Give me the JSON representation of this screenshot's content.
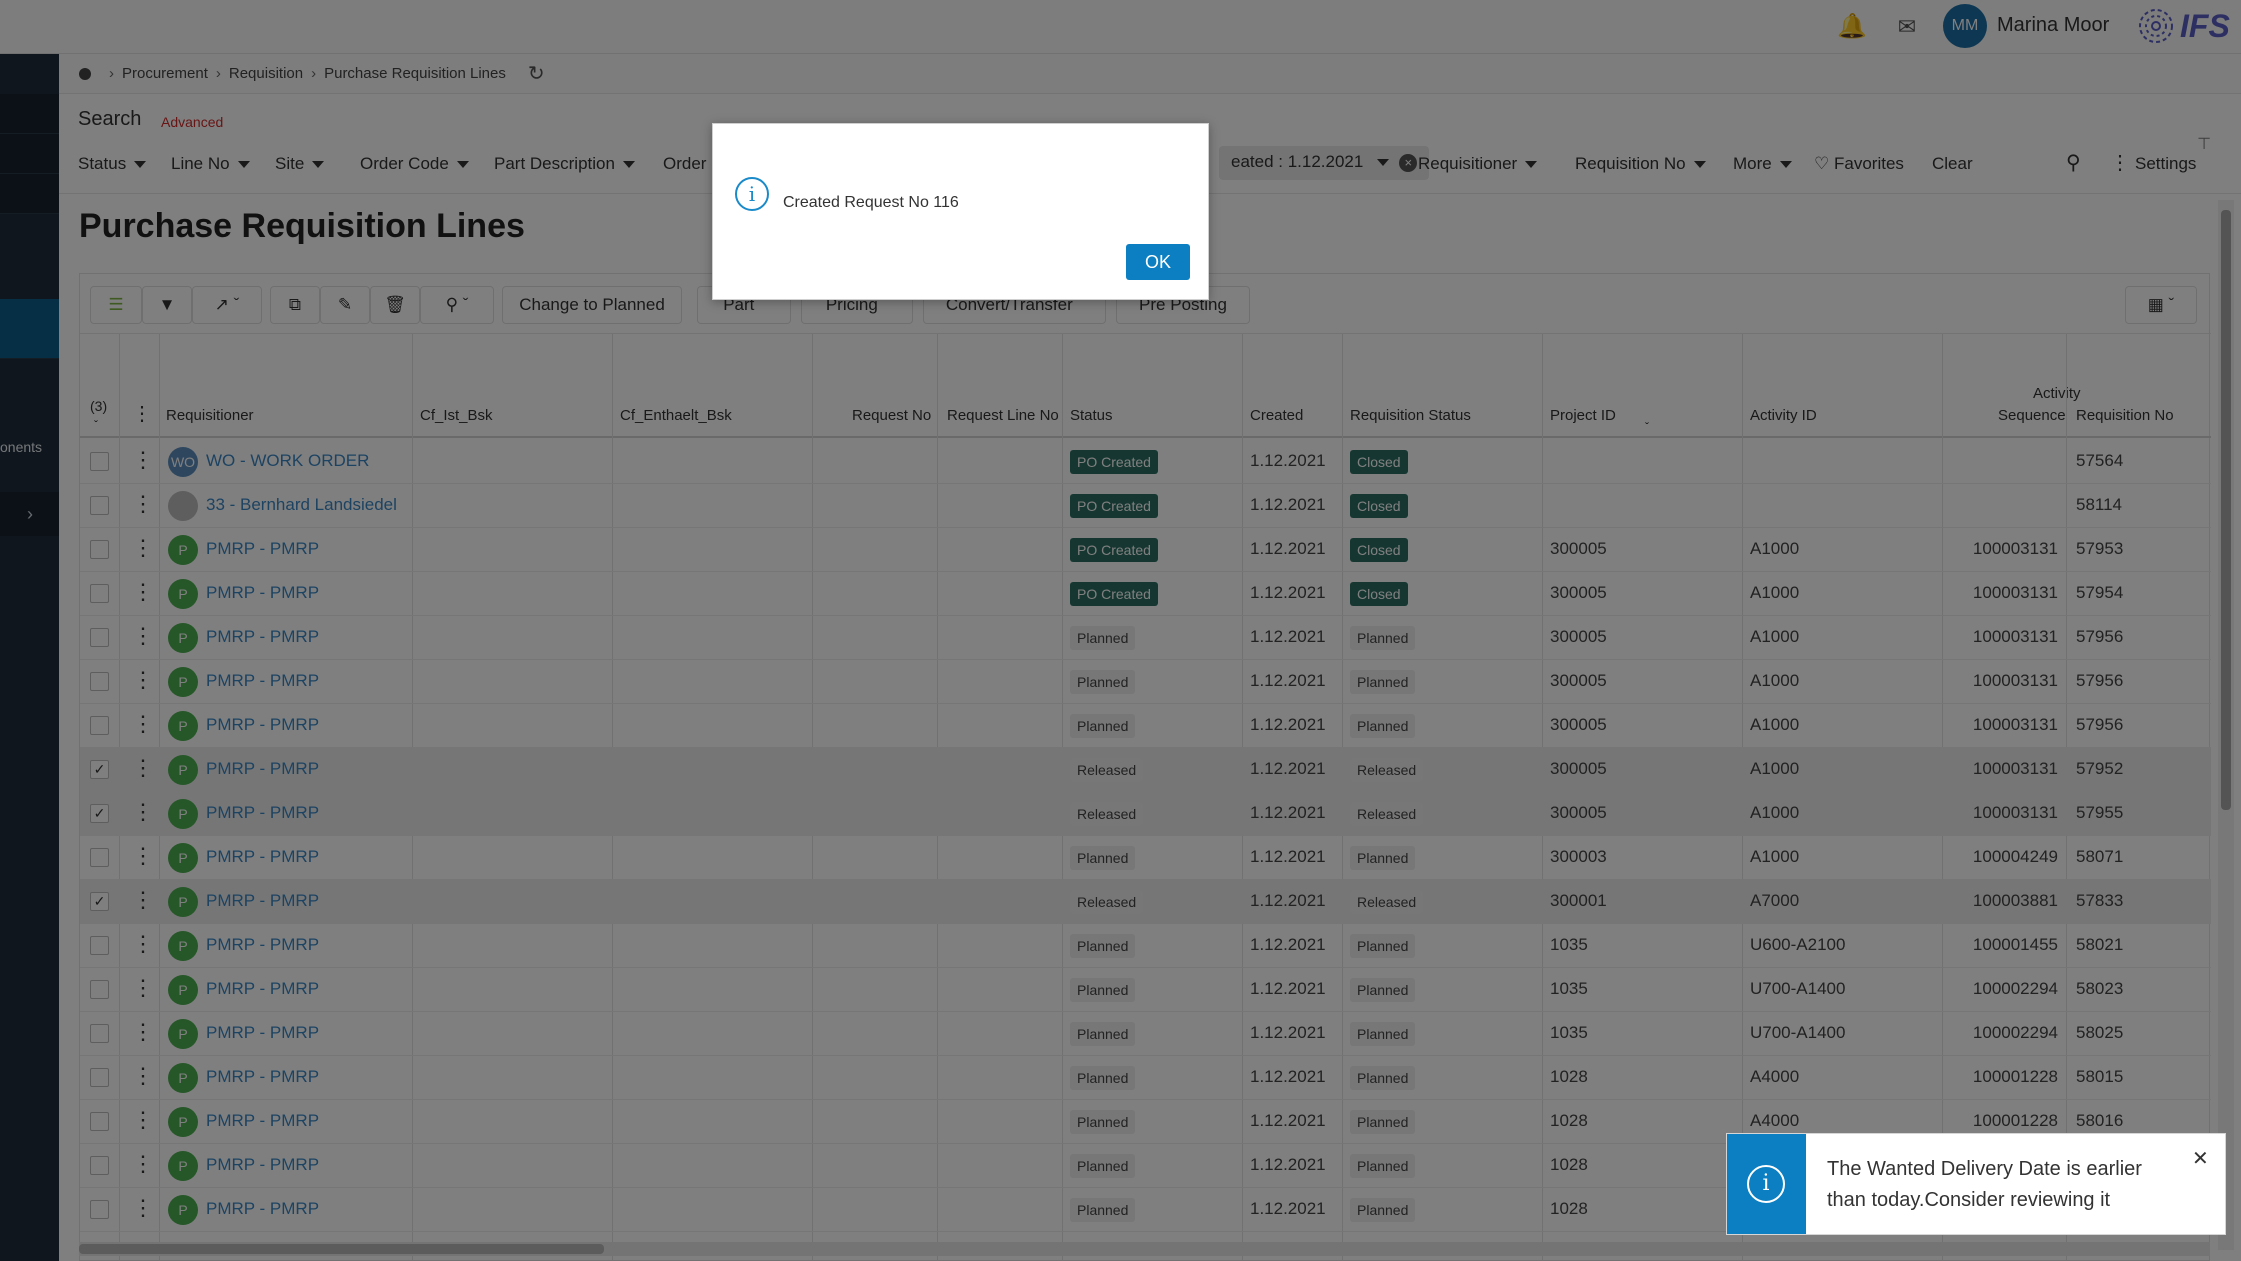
{
  "topbar": {
    "user_initials": "MM",
    "user_name": "Marina Moor",
    "logo_text": "IFS"
  },
  "nav": {
    "components_label": "onents"
  },
  "breadcrumb": [
    "Procurement",
    "Requisition",
    "Purchase Requisition Lines"
  ],
  "search": {
    "title": "Search",
    "advanced": "Advanced",
    "filters": [
      "Status",
      "Line No",
      "Site",
      "Order Code",
      "Part Description",
      "Order"
    ],
    "chip": "eated : 1.12.2021",
    "filters_right": [
      "Requisitioner",
      "Requisition No",
      "More"
    ],
    "favorites": "Favorites",
    "clear": "Clear",
    "settings": "Settings"
  },
  "page_title": "Purchase Requisition Lines",
  "toolbar": {
    "change_to_planned": "Change to Planned",
    "part": "Part",
    "pricing": "Pricing",
    "convert_transfer": "Convert/Transfer",
    "pre_posting": "Pre Posting"
  },
  "grid": {
    "selected_count": "(3)",
    "columns": {
      "requisitioner": "Requisitioner",
      "cf_ist": "Cf_Ist_Bsk",
      "cf_enthaelt": "Cf_Enthaelt_Bsk",
      "request_no": "Request No",
      "request_line_no": "Request Line No",
      "status": "Status",
      "created": "Created",
      "requisition_status": "Requisition Status",
      "project_id": "Project ID",
      "activity_id": "Activity ID",
      "activity_sequence_1": "Activity",
      "activity_sequence_2": "Sequence",
      "requisition_no": "Requisition No"
    },
    "rows": [
      {
        "checked": false,
        "avatar": "WO",
        "requisitioner": "WO - WORK ORDER",
        "status": "PO Created",
        "created": "1.12.2021",
        "req_status": "Closed",
        "project": "",
        "activity": "",
        "sequence": "",
        "req_no": "57564"
      },
      {
        "checked": false,
        "avatar": "",
        "requisitioner": "33 - Bernhard Landsiedel",
        "status": "PO Created",
        "created": "1.12.2021",
        "req_status": "Closed",
        "project": "",
        "activity": "",
        "sequence": "",
        "req_no": "58114"
      },
      {
        "checked": false,
        "avatar": "P",
        "requisitioner": "PMRP - PMRP",
        "status": "PO Created",
        "created": "1.12.2021",
        "req_status": "Closed",
        "project": "300005",
        "activity": "A1000",
        "sequence": "100003131",
        "req_no": "57953"
      },
      {
        "checked": false,
        "avatar": "P",
        "requisitioner": "PMRP - PMRP",
        "status": "PO Created",
        "created": "1.12.2021",
        "req_status": "Closed",
        "project": "300005",
        "activity": "A1000",
        "sequence": "100003131",
        "req_no": "57954"
      },
      {
        "checked": false,
        "avatar": "P",
        "requisitioner": "PMRP - PMRP",
        "status": "Planned",
        "created": "1.12.2021",
        "req_status": "Planned",
        "project": "300005",
        "activity": "A1000",
        "sequence": "100003131",
        "req_no": "57956"
      },
      {
        "checked": false,
        "avatar": "P",
        "requisitioner": "PMRP - PMRP",
        "status": "Planned",
        "created": "1.12.2021",
        "req_status": "Planned",
        "project": "300005",
        "activity": "A1000",
        "sequence": "100003131",
        "req_no": "57956"
      },
      {
        "checked": false,
        "avatar": "P",
        "requisitioner": "PMRP - PMRP",
        "status": "Planned",
        "created": "1.12.2021",
        "req_status": "Planned",
        "project": "300005",
        "activity": "A1000",
        "sequence": "100003131",
        "req_no": "57956"
      },
      {
        "checked": true,
        "avatar": "P",
        "requisitioner": "PMRP - PMRP",
        "status": "Released",
        "created": "1.12.2021",
        "req_status": "Released",
        "project": "300005",
        "activity": "A1000",
        "sequence": "100003131",
        "req_no": "57952"
      },
      {
        "checked": true,
        "avatar": "P",
        "requisitioner": "PMRP - PMRP",
        "status": "Released",
        "created": "1.12.2021",
        "req_status": "Released",
        "project": "300005",
        "activity": "A1000",
        "sequence": "100003131",
        "req_no": "57955"
      },
      {
        "checked": false,
        "avatar": "P",
        "requisitioner": "PMRP - PMRP",
        "status": "Planned",
        "created": "1.12.2021",
        "req_status": "Planned",
        "project": "300003",
        "activity": "A1000",
        "sequence": "100004249",
        "req_no": "58071"
      },
      {
        "checked": true,
        "avatar": "P",
        "requisitioner": "PMRP - PMRP",
        "status": "Released",
        "created": "1.12.2021",
        "req_status": "Released",
        "project": "300001",
        "activity": "A7000",
        "sequence": "100003881",
        "req_no": "57833"
      },
      {
        "checked": false,
        "avatar": "P",
        "requisitioner": "PMRP - PMRP",
        "status": "Planned",
        "created": "1.12.2021",
        "req_status": "Planned",
        "project": "1035",
        "activity": "U600-A2100",
        "sequence": "100001455",
        "req_no": "58021"
      },
      {
        "checked": false,
        "avatar": "P",
        "requisitioner": "PMRP - PMRP",
        "status": "Planned",
        "created": "1.12.2021",
        "req_status": "Planned",
        "project": "1035",
        "activity": "U700-A1400",
        "sequence": "100002294",
        "req_no": "58023"
      },
      {
        "checked": false,
        "avatar": "P",
        "requisitioner": "PMRP - PMRP",
        "status": "Planned",
        "created": "1.12.2021",
        "req_status": "Planned",
        "project": "1035",
        "activity": "U700-A1400",
        "sequence": "100002294",
        "req_no": "58025"
      },
      {
        "checked": false,
        "avatar": "P",
        "requisitioner": "PMRP - PMRP",
        "status": "Planned",
        "created": "1.12.2021",
        "req_status": "Planned",
        "project": "1028",
        "activity": "A4000",
        "sequence": "100001228",
        "req_no": "58015"
      },
      {
        "checked": false,
        "avatar": "P",
        "requisitioner": "PMRP - PMRP",
        "status": "Planned",
        "created": "1.12.2021",
        "req_status": "Planned",
        "project": "1028",
        "activity": "A4000",
        "sequence": "100001228",
        "req_no": "58016"
      },
      {
        "checked": false,
        "avatar": "P",
        "requisitioner": "PMRP - PMRP",
        "status": "Planned",
        "created": "1.12.2021",
        "req_status": "Planned",
        "project": "1028",
        "activity": "",
        "sequence": "",
        "req_no": ""
      },
      {
        "checked": false,
        "avatar": "P",
        "requisitioner": "PMRP - PMRP",
        "status": "Planned",
        "created": "1.12.2021",
        "req_status": "Planned",
        "project": "1028",
        "activity": "",
        "sequence": "",
        "req_no": ""
      }
    ]
  },
  "dialog": {
    "message": "Created Request No 116",
    "ok_label": "OK"
  },
  "toast": {
    "message": "The Wanted Delivery Date is earlier than today.Consider reviewing it"
  },
  "colors": {
    "accent": "#0b7fc2",
    "closed_badge": "#2d6e63",
    "link": "#3b87c4",
    "avatar_green": "#4caf50",
    "nav_bg": "#1f2d3a"
  },
  "icons": [
    "bell-icon",
    "chat-icon",
    "info-icon",
    "close-icon",
    "refresh-icon",
    "search-icon",
    "heart-icon",
    "pin-icon"
  ]
}
